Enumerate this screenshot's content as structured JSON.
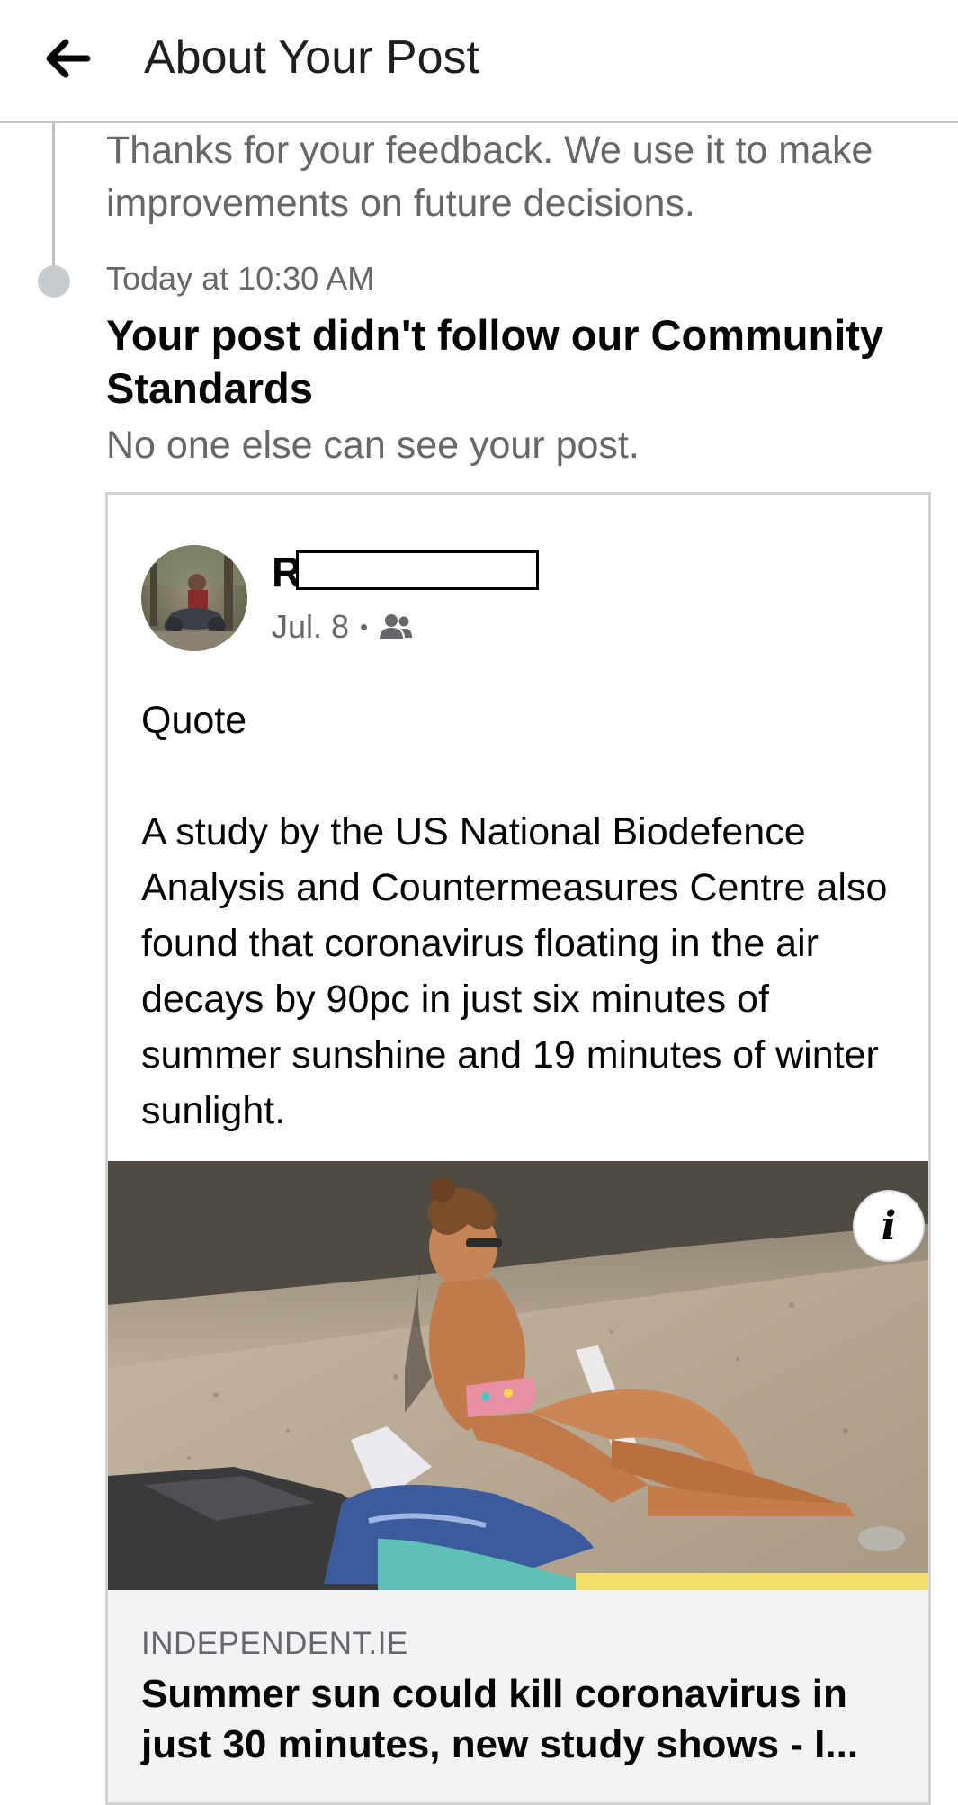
{
  "header": {
    "title": "About Your Post",
    "back_icon": "arrow-left-icon"
  },
  "timeline": {
    "feedback_text": "Thanks for your feedback. We use it to make improvements on future decisions.",
    "event": {
      "time": "Today at 10:30 AM",
      "title": "Your post didn't follow our Community Standards",
      "subtitle": "No one else can see your post."
    }
  },
  "post": {
    "author_initial": "R",
    "date": "Jul. 8",
    "separator": "•",
    "audience_icon": "friends-icon",
    "text": "Quote\n\nA study by the US National Biodefence Analysis and Countermeasures Centre also found that coronavirus floating in the air decays by 90pc in just six minutes of summer sunshine and 19 minutes of winter sunlight.",
    "link": {
      "info_label": "i",
      "domain": "INDEPENDENT.IE",
      "title": "Summer sun could kill coronavirus in just 30 minutes, new study shows - I..."
    }
  },
  "colors": {
    "secondary_text": "#65676b",
    "primary_text": "#050505",
    "link_footer_bg": "#f2f3f5",
    "divider": "#c8c8c8"
  }
}
